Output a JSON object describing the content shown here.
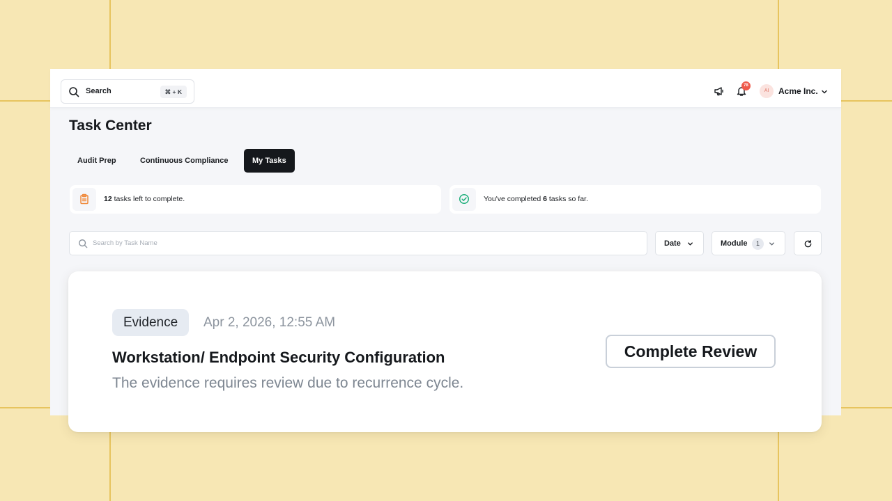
{
  "topbar": {
    "search_label": "Search",
    "search_shortcut": "⌘ + K",
    "notification_count": "78",
    "avatar_initials": "AI",
    "org_name": "Acme Inc."
  },
  "page": {
    "title": "Task Center"
  },
  "tabs": [
    {
      "label": "Audit Prep",
      "active": false
    },
    {
      "label": "Continuous Compliance",
      "active": false
    },
    {
      "label": "My Tasks",
      "active": true
    }
  ],
  "stats": {
    "left_count": "12",
    "left_text": " tasks left to complete.",
    "done_prefix": "You've completed ",
    "done_count": "6",
    "done_suffix": " tasks so far."
  },
  "filters": {
    "search_placeholder": "Search by Task Name",
    "date_label": "Date",
    "module_label": "Module",
    "module_count": "1"
  },
  "task": {
    "category": "Evidence",
    "date": "Apr 2, 2026, 12:55 AM",
    "title": "Workstation/ Endpoint Security Configuration",
    "description": "The evidence requires review due to recurrence cycle.",
    "action_label": "Complete Review"
  },
  "colors": {
    "backdrop": "#f7e7b4",
    "active_tab": "#15181c",
    "notification_badge": "#ef5a4b",
    "clipboard_icon": "#f08a3c",
    "check_icon": "#22b07d"
  },
  "icons": [
    "search-icon",
    "megaphone-icon",
    "bell-icon",
    "chevron-down-icon",
    "clipboard-icon",
    "check-circle-icon",
    "refresh-icon"
  ]
}
